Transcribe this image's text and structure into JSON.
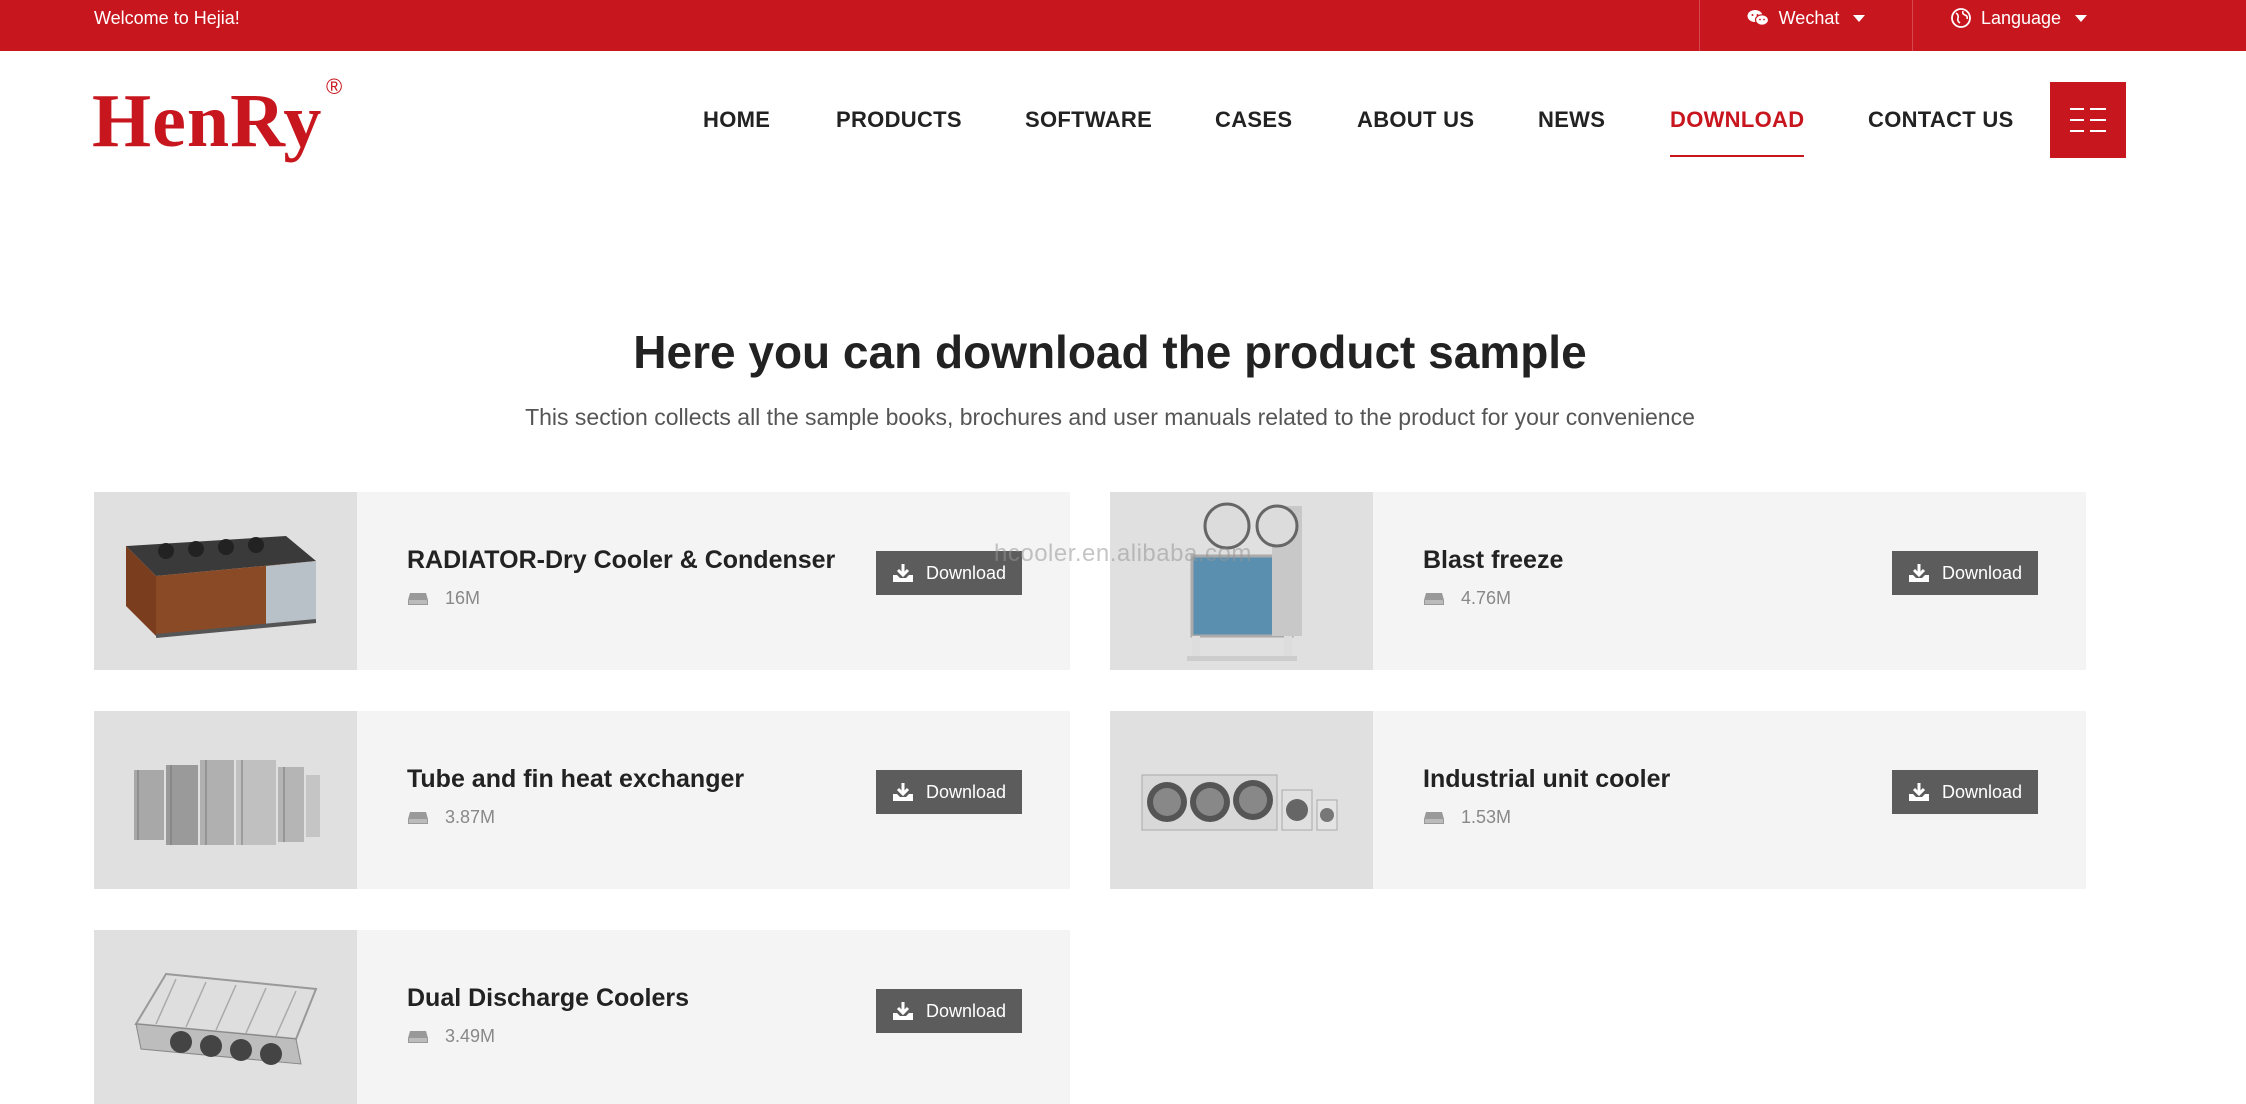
{
  "topbar": {
    "welcome": "Welcome to Hejia!",
    "wechat_label": "Wechat",
    "language_label": "Language"
  },
  "header": {
    "logo_text": "HenRy",
    "logo_mark": "®"
  },
  "nav": {
    "items": [
      {
        "label": "HOME"
      },
      {
        "label": "PRODUCTS"
      },
      {
        "label": "SOFTWARE"
      },
      {
        "label": "CASES"
      },
      {
        "label": "ABOUT US"
      },
      {
        "label": "NEWS"
      },
      {
        "label": "DOWNLOAD"
      },
      {
        "label": "CONTACT US"
      }
    ],
    "active": "DOWNLOAD"
  },
  "hero": {
    "title": "Here you can download the product sample",
    "subtitle": "This section collects all the sample books, brochures and user manuals related to the product for your convenience"
  },
  "downloads": [
    {
      "title": "RADIATOR-Dry Cooler & Condenser",
      "size": "16M",
      "button": "Download"
    },
    {
      "title": "Blast freeze",
      "size": "4.76M",
      "button": "Download"
    },
    {
      "title": "Tube and fin heat exchanger",
      "size": "3.87M",
      "button": "Download"
    },
    {
      "title": "Industrial unit cooler",
      "size": "1.53M",
      "button": "Download"
    },
    {
      "title": "Dual Discharge Coolers",
      "size": "3.49M",
      "button": "Download"
    }
  ],
  "watermark": "hcooler.en.alibaba.com",
  "colors": {
    "brand_red": "#c8161e",
    "button_gray": "#5c5c5c",
    "card_bg": "#f4f4f4",
    "thumb_bg": "#e0e0e0"
  }
}
